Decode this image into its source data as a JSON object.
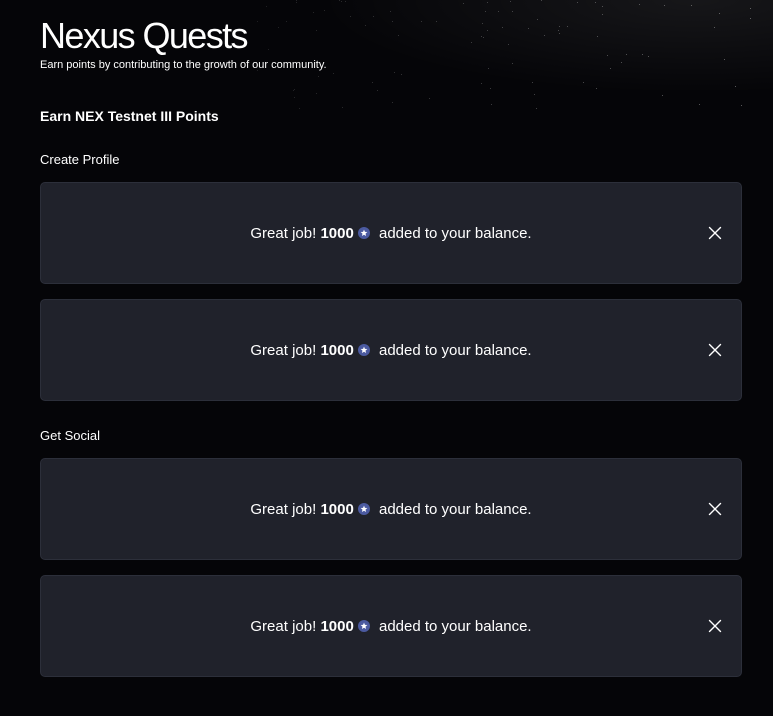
{
  "header": {
    "title": "Nexus Quests",
    "subtitle": "Earn points by contributing to the growth of our community."
  },
  "section": {
    "heading": "Earn NEX Testnet III Points"
  },
  "groups": [
    {
      "label": "Create Profile",
      "cards": [
        {
          "prefix": "Great job! ",
          "points": "1000",
          "suffix": " added to your balance."
        },
        {
          "prefix": "Great job! ",
          "points": "1000",
          "suffix": " added to your balance."
        }
      ]
    },
    {
      "label": "Get Social",
      "cards": [
        {
          "prefix": "Great job! ",
          "points": "1000",
          "suffix": " added to your balance."
        },
        {
          "prefix": "Great job! ",
          "points": "1000",
          "suffix": " added to your balance."
        }
      ]
    }
  ],
  "icons": {
    "points": "star-badge-icon",
    "dismiss": "close-icon"
  },
  "colors": {
    "background": "#050508",
    "card": "#20222b",
    "badge": "#4b5aa0",
    "text": "#ffffff"
  }
}
